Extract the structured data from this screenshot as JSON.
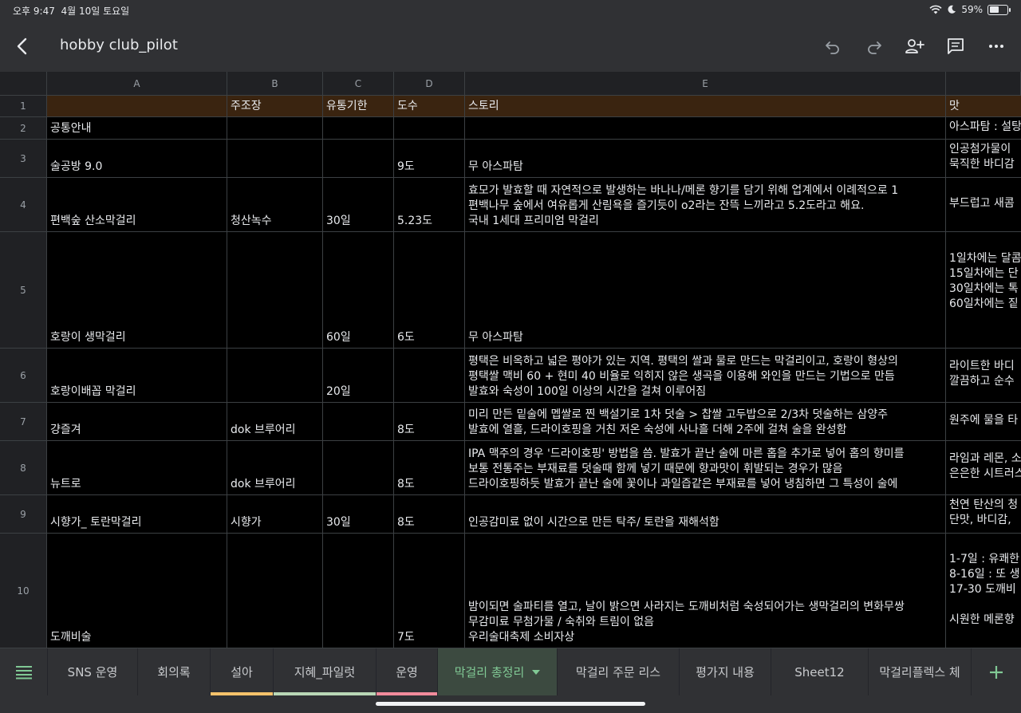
{
  "status_bar": {
    "time": "오후 9:47",
    "date": "4월 10일 토요일",
    "battery_percent": "59%",
    "battery_level": 0.59
  },
  "toolbar": {
    "title": "hobby club_pilot",
    "icons": [
      "back-icon",
      "undo-icon",
      "redo-icon",
      "add-person-icon",
      "comment-icon",
      "more-icon"
    ]
  },
  "sheet": {
    "columns": [
      "A",
      "B",
      "C",
      "D",
      "E"
    ],
    "rows": [
      {
        "num": "1",
        "a": "",
        "b": "주조장",
        "c": "유통기한",
        "d": "도수",
        "e": [
          "스토리"
        ],
        "f": [
          "맛"
        ]
      },
      {
        "num": "2",
        "a": "공통안내",
        "b": "",
        "c": "",
        "d": "",
        "e": [],
        "f": [
          "아스파탐 : 설탕"
        ]
      },
      {
        "num": "3",
        "a": "술공방 9.0",
        "b": "",
        "c": "",
        "d": "9도",
        "e": [
          "무 아스파탐"
        ],
        "f": [
          "인공첨가물이 ",
          "묵직한 바디감"
        ]
      },
      {
        "num": "4",
        "a": "편백숲 산소막걸리",
        "b": "청산녹수",
        "c": "30일",
        "d": "5.23도",
        "e": [
          "효모가 발효할 때 자연적으로 발생하는 바나나/메론 향기를 담기 위해 업계에서 이례적으로 1",
          "편백나무 숲에서 여유롭게 산림욕을 즐기듯이 o2라는 잔뜩 느끼라고 5.2도라고 해요.",
          "국내 1세대 프리미엄 막걸리"
        ],
        "f": [
          "부드럽고 새콤"
        ]
      },
      {
        "num": "5",
        "a": "호랑이 생막걸리",
        "b": "",
        "c": "60일",
        "d": "6도",
        "e": [
          "무 아스파탐"
        ],
        "f": [
          "1일차에는 달콤",
          "15일차에는 단",
          "30일차에는 톡",
          "60일차에는 짙",
          ""
        ]
      },
      {
        "num": "6",
        "a": "호랑이배꼽 막걸리",
        "b": "",
        "c": "20일",
        "d": "",
        "e": [
          "평택은 비옥하고 넓은 평야가 있는 지역. 평택의 쌀과 물로 만드는 막걸리이고, 호랑이 형상의",
          "평택쌀 맥비 60 + 현미 40 비율로 익히지 않은 생곡을 이용해 와인을 만드는 기법으로 만듬",
          "발효와 숙성이 100일 이상의 시간을 걸쳐 이루어짐"
        ],
        "f": [
          "라이트한 바디",
          "깔끔하고 순수"
        ]
      },
      {
        "num": "7",
        "a": "걍즐겨",
        "b": "dok 브루어리",
        "c": "",
        "d": "8도",
        "e": [
          "미리 만든 밑술에 멥쌀로 찐 백설기로 1차 덧술 > 찹쌀 고두밥으로 2/3차 덧술하는 삼양주",
          "발효에 열흘, 드라이호핑을 거친 저온 숙성에 사나흘 더해 2주에 걸쳐 술을 완성함"
        ],
        "f": [
          "원주에 물을 타"
        ]
      },
      {
        "num": "8",
        "a": "뉴트로",
        "b": "dok 브루어리",
        "c": "",
        "d": "8도",
        "e": [
          "IPA 맥주의 경우 '드라이호핑' 방법을 씀. 발효가 끝난 술에 마른 홉을 추가로 넣어 홉의 향미를",
          "보통 전통주는 부재료를 덧술때 함께 넣기 때문에 향과맛이 휘발되는 경우가 많음",
          "드라이호핑하듯 발효가 끝난 술에 꽃이나 과일즙같은 부재료를 넣어 냉침하면 그 특성이 술에"
        ],
        "f": [
          "라임과 레몬, 소",
          "은은한 시트러스"
        ]
      },
      {
        "num": "9",
        "a": "시향가_ 토란막걸리",
        "b": "시향가",
        "c": "30일",
        "d": "8도",
        "e": [
          "인공감미료 없이 시간으로 만든 탁주/ 토란을 재해석함"
        ],
        "f": [
          "천연 탄산의 청",
          "단맛, 바디감,"
        ]
      },
      {
        "num": "10",
        "a": "도깨비술",
        "b": "",
        "c": "",
        "d": "7도",
        "e": [
          "밤이되면 술파티를 열고, 날이 밝으면 사라지는 도깨비처럼 숙성되어가는 생막걸리의 변화무쌍",
          "무감미료 무첨가물 / 숙취와 트림이 없음",
          "우리술대축제 소비자상"
        ],
        "f": [
          "1-7일 : 유쾌한",
          "8-16일 : 또 생",
          "17-30 도깨비",
          "",
          "시원한 메론향"
        ]
      }
    ]
  },
  "tabs": [
    {
      "label": "SNS 운영"
    },
    {
      "label": "회의록"
    },
    {
      "label": "설아"
    },
    {
      "label": "지혜_파일럿"
    },
    {
      "label": "운영"
    },
    {
      "label": "막걸리 총정리"
    },
    {
      "label": "막걸리 주문 리스"
    },
    {
      "label": "평가지 내용"
    },
    {
      "label": "Sheet12"
    },
    {
      "label": "막걸리플렉스 체"
    }
  ],
  "colors": {
    "active_tab": "#81c995",
    "tab_underline_설아": "#f6c26b",
    "tab_underline_지혜": "#b9d7b6",
    "tab_underline_운영": "#f28b9b",
    "header_row_bg": "#3a2410"
  }
}
